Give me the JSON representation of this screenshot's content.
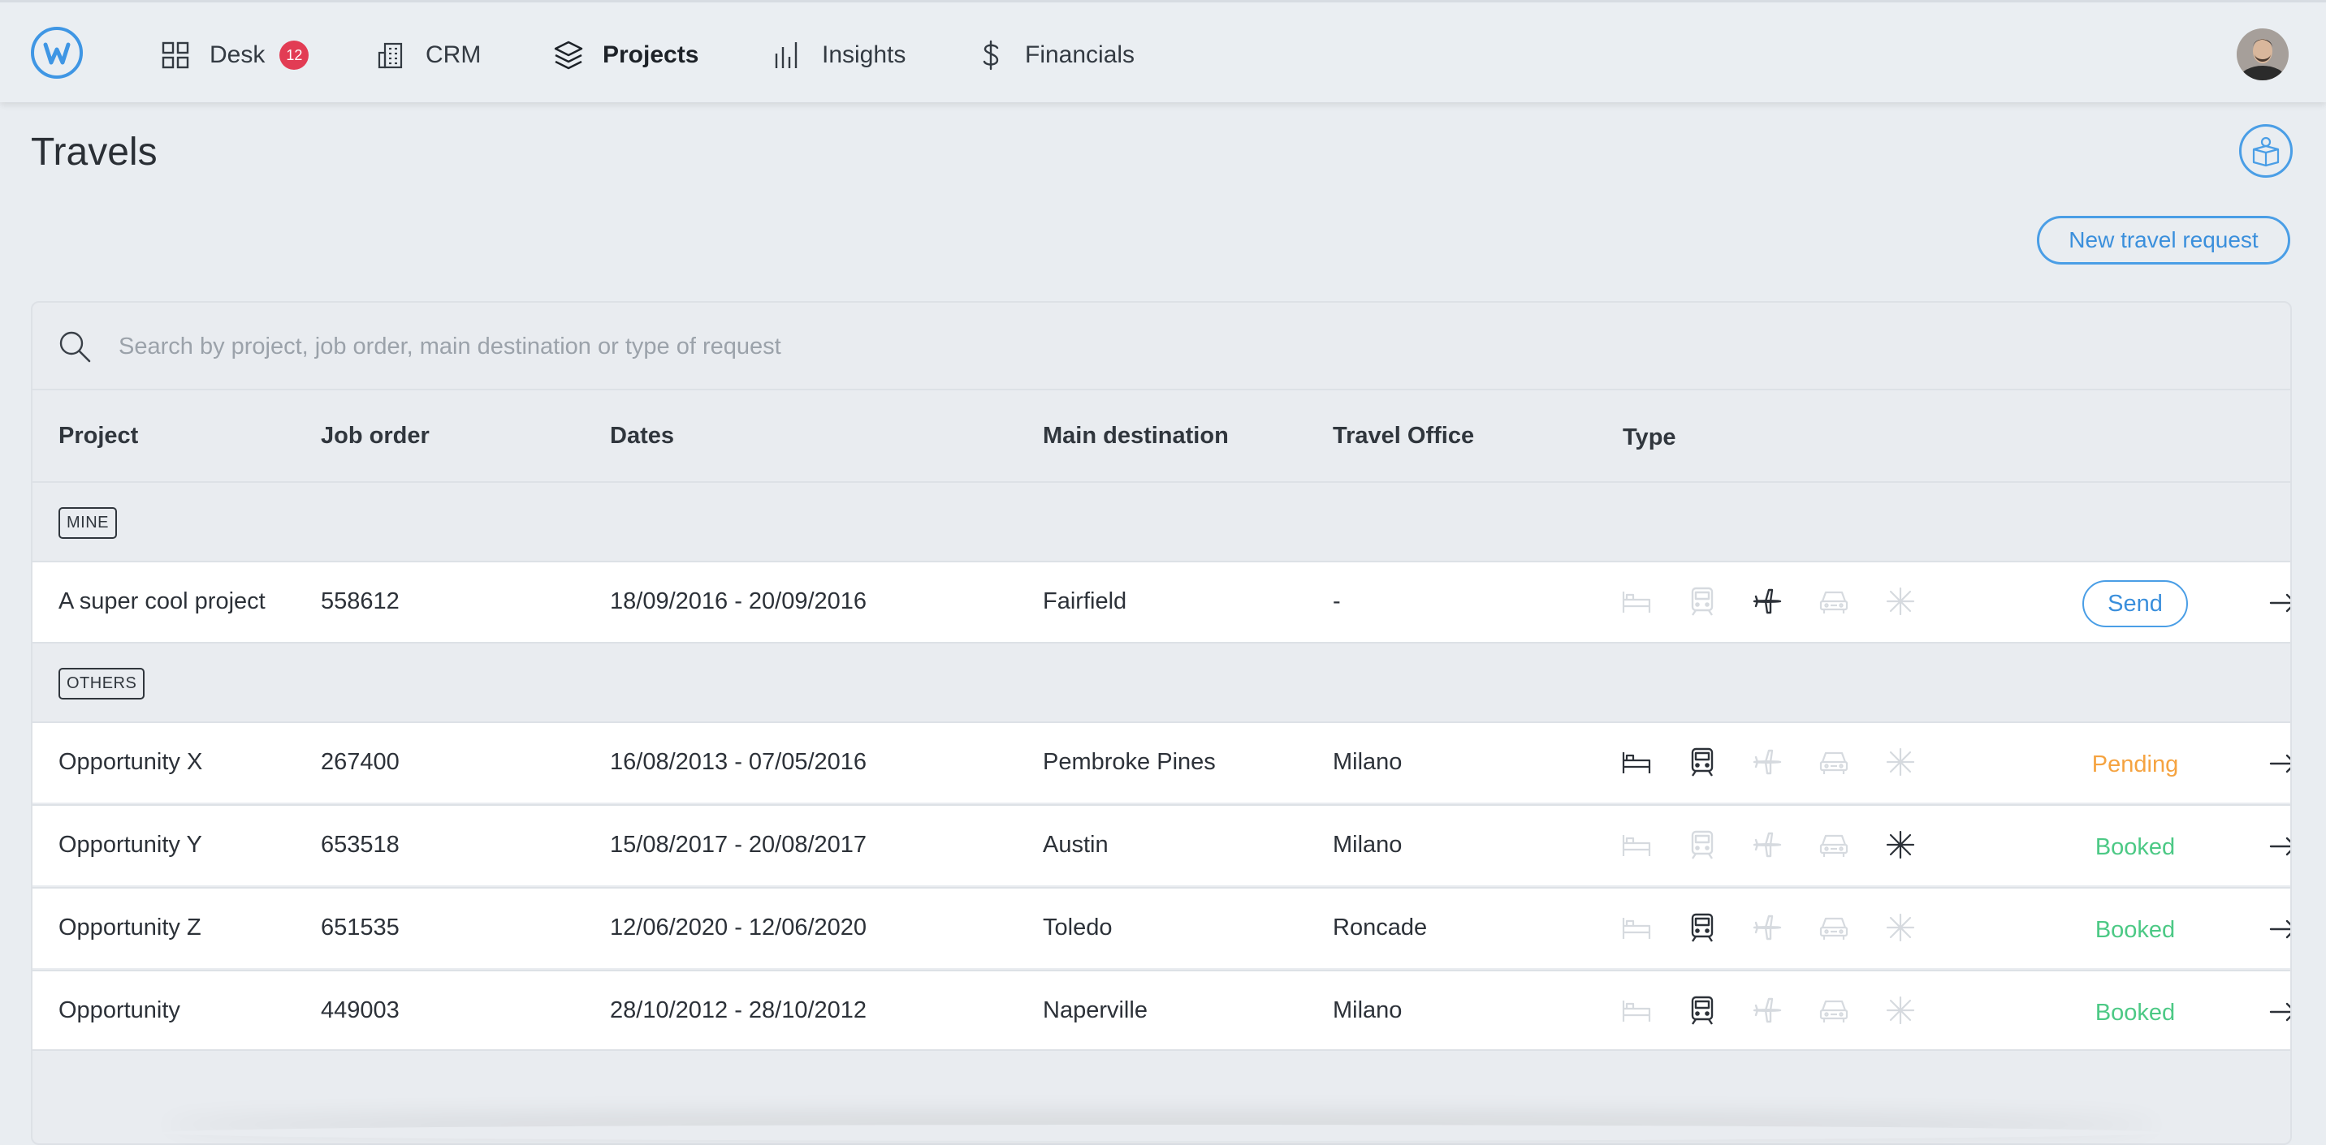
{
  "nav": {
    "logo_letter": "W",
    "items": [
      {
        "label": "Desk",
        "badge": "12",
        "icon": "grid-icon"
      },
      {
        "label": "CRM",
        "icon": "building-icon"
      },
      {
        "label": "Projects",
        "icon": "layers-icon",
        "active": true
      },
      {
        "label": "Insights",
        "icon": "bar-chart-icon"
      },
      {
        "label": "Financials",
        "icon": "dollar-icon"
      }
    ]
  },
  "page": {
    "title": "Travels",
    "new_request_label": "New travel request",
    "search_placeholder": "Search by project, job order, main destination or type of request"
  },
  "table": {
    "headers": {
      "project": "Project",
      "job_order": "Job order",
      "dates": "Dates",
      "destination": "Main destination",
      "office": "Travel Office",
      "type": "Type"
    },
    "groups": {
      "mine": "MINE",
      "others": "OTHERS"
    },
    "rows": [
      {
        "project": "A super cool project",
        "job_order": "558612",
        "dates": "18/09/2016 - 20/09/2016",
        "destination": "Fairfield",
        "office": "-",
        "types": {
          "hotel": false,
          "train": false,
          "flight": true,
          "car": false,
          "other": false
        },
        "status": "Send"
      },
      {
        "project": "Opportunity X",
        "job_order": "267400",
        "dates": "16/08/2013 - 07/05/2016",
        "destination": "Pembroke Pines",
        "office": "Milano",
        "types": {
          "hotel": true,
          "train": true,
          "flight": false,
          "car": false,
          "other": false
        },
        "status": "Pending"
      },
      {
        "project": "Opportunity Y",
        "job_order": "653518",
        "dates": "15/08/2017 - 20/08/2017",
        "destination": "Austin",
        "office": "Milano",
        "types": {
          "hotel": false,
          "train": false,
          "flight": false,
          "car": false,
          "other": true
        },
        "status": "Booked"
      },
      {
        "project": "Opportunity Z",
        "job_order": "651535",
        "dates": "12/06/2020 - 12/06/2020",
        "destination": "Toledo",
        "office": "Roncade",
        "types": {
          "hotel": false,
          "train": true,
          "flight": false,
          "car": false,
          "other": false
        },
        "status": "Booked"
      },
      {
        "project": "Opportunity",
        "job_order": "449003",
        "dates": "28/10/2012 - 28/10/2012",
        "destination": "Naperville",
        "office": "Milano",
        "types": {
          "hotel": false,
          "train": true,
          "flight": false,
          "car": false,
          "other": false
        },
        "status": "Booked"
      }
    ]
  },
  "colors": {
    "accent": "#3a8fdc",
    "pending": "#f5a340",
    "booked": "#4cc985",
    "badge": "#e23c54",
    "icon_active": "#2c3138",
    "icon_inactive": "#d6dadf"
  }
}
